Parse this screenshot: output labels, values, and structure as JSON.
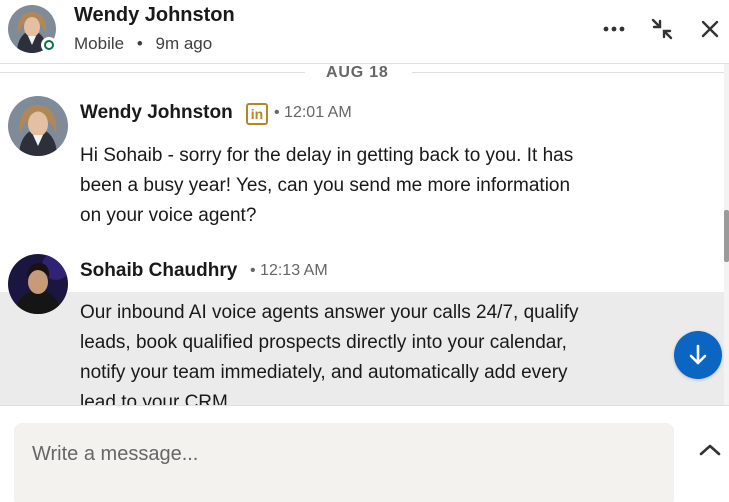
{
  "header": {
    "name": "Wendy Johnston",
    "device": "Mobile",
    "separator": "•",
    "last_seen": "9m ago",
    "presence_color": "#057642",
    "actions": [
      "more-icon",
      "minimize-icon",
      "close-icon"
    ]
  },
  "divider": {
    "date": "AUG 18"
  },
  "messages": [
    {
      "sender": "Wendy Johnston",
      "badge": "in",
      "time": "• 12:01 AM",
      "lines": [
        "Hi Sohaib - sorry for the delay in getting back to you. It has",
        "been a busy year! Yes, can you send me more information",
        "on your voice agent?"
      ]
    },
    {
      "sender": "Sohaib Chaudhry",
      "time": "• 12:13 AM",
      "lines": [
        "Our inbound AI voice agents answer your calls 24/7, qualify",
        "leads, book qualified prospects directly into your calendar,",
        "notify your team immediately, and automatically add every",
        "lead to your CRM."
      ]
    }
  ],
  "composer": {
    "placeholder": "Write a message..."
  },
  "colors": {
    "accent": "#0a66c2",
    "badge": "#b5852a",
    "highlight": "#ebebeb",
    "composer_bg": "#f4f2ee"
  }
}
